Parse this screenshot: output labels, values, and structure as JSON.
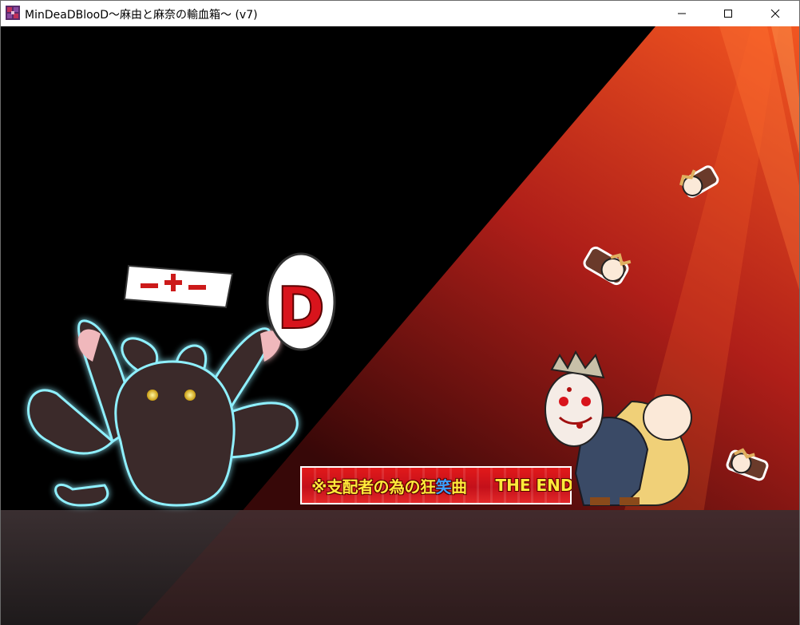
{
  "window": {
    "title": "MinDeaDBlooD～麻由と麻奈の輸血箱～ (v7)",
    "icon": "game-app-icon",
    "controls": {
      "minimize": "minimize-icon",
      "maximize": "maximize-icon",
      "close": "close-icon"
    }
  },
  "scene": {
    "nurse_cap_symbol": "ー+ー",
    "d_badge_letter": "D",
    "banner": {
      "prefix": "※支配者の為の狂",
      "highlight": "笑",
      "suffix": "曲",
      "end_text": "THE END"
    },
    "colors": {
      "background": "#000000",
      "spotlight": "#e8341c",
      "floor": "#2a2526",
      "banner_red": "#d8141c",
      "banner_text": "#ffea3a",
      "banner_highlight": "#3aa0ff",
      "monster_glow": "#8ff0ff"
    }
  }
}
